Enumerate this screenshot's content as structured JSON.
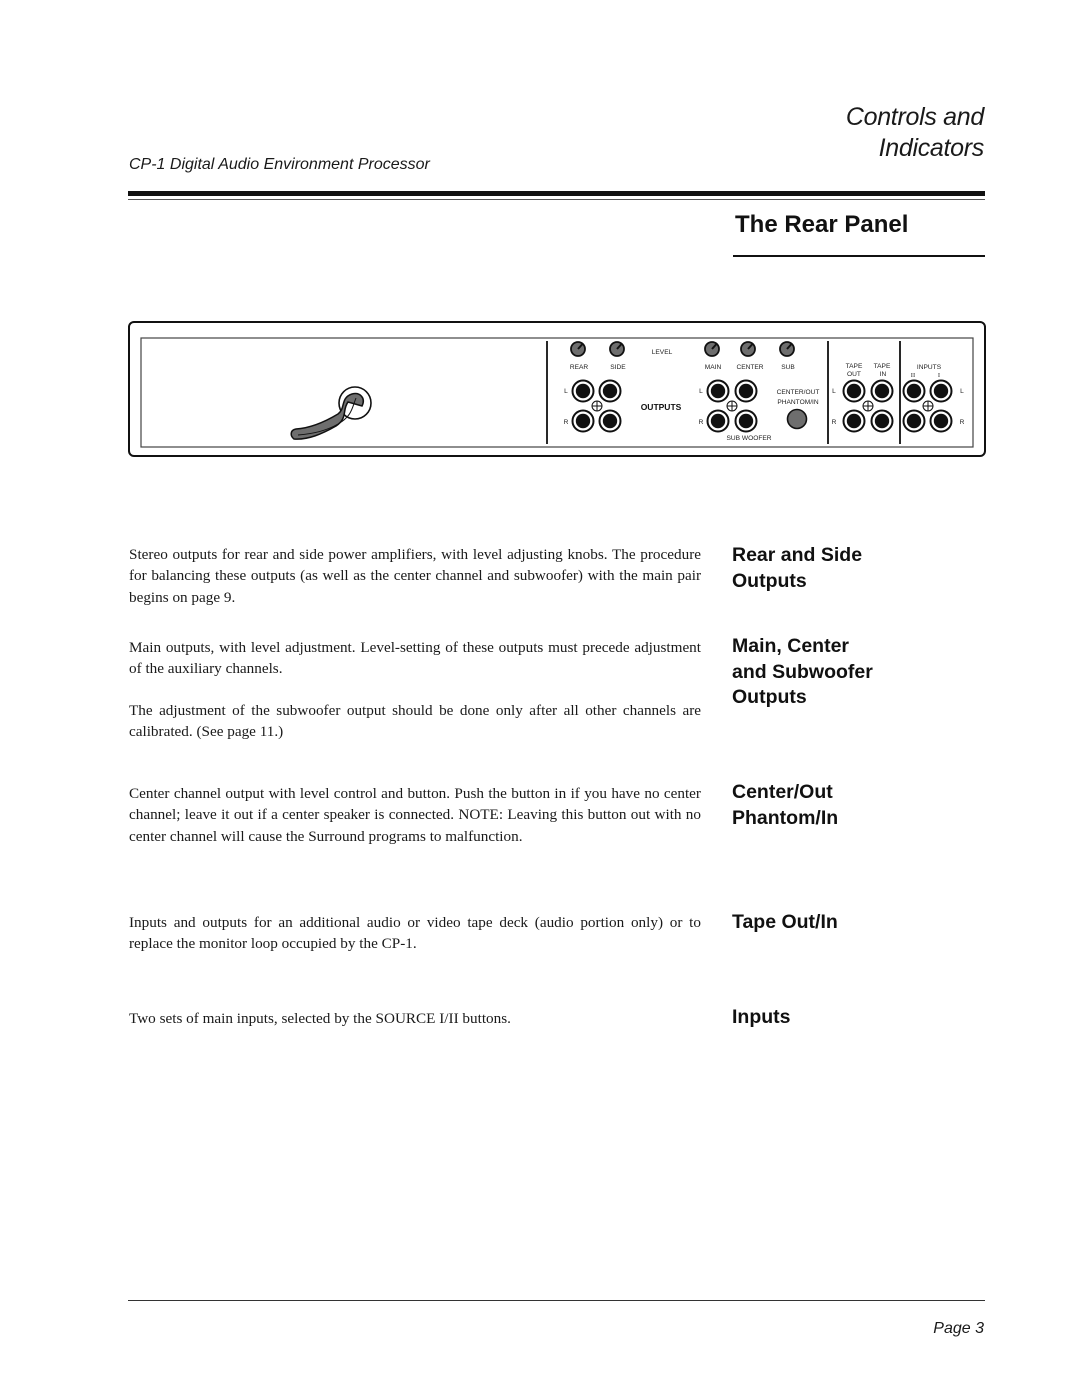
{
  "header": {
    "title_line1": "Controls and",
    "title_line2": "Indicators",
    "subtitle": "CP-1 Digital Audio Environment Processor"
  },
  "section": {
    "title": "The Rear Panel"
  },
  "rear_panel_diagram": {
    "icons": [
      "power-cord-icon",
      "level-knob-icon",
      "rca-jack-icon",
      "ground-symbol-icon",
      "push-button-icon"
    ],
    "labels": {
      "level": "LEVEL",
      "rear": "REAR",
      "side": "SIDE",
      "main": "MAIN",
      "center": "CENTER",
      "sub": "SUB",
      "outputs": "OUTPUTS",
      "left": "L",
      "right": "R",
      "center_out_line1": "CENTER/OUT",
      "center_out_line2": "PHANTOM/IN",
      "sub_woofer": "SUB WOOFER",
      "tape_out_line1": "TAPE",
      "tape_out_line2": "OUT",
      "tape_in_line1": "TAPE",
      "tape_in_line2": "IN",
      "inputs": "INPUTS",
      "input_ii": "II",
      "input_i": "I"
    }
  },
  "descriptions": [
    {
      "heading_lines": [
        "Rear and Side",
        "Outputs"
      ],
      "paragraphs": [
        "Stereo outputs for rear and side power amplifiers, with level adjusting knobs.  The procedure for balancing these outputs (as well as the center channel and subwoofer) with the main pair begins on page 9."
      ]
    },
    {
      "heading_lines": [
        "Main, Center",
        "and Subwoofer",
        "Outputs"
      ],
      "paragraphs": [
        "Main outputs, with level adjustment. Level-setting of these outputs  must precede adjustment of the auxiliary channels.",
        "The adjustment of the subwoofer output should be done only after all other channels are calibrated. (See page 11.)"
      ]
    },
    {
      "heading_lines": [
        "Center/Out",
        "Phantom/In"
      ],
      "paragraphs": [
        "Center channel output with level control and button.  Push the button in if you have no center channel; leave it out if a center speaker is connected. NOTE: Leaving this button out with no center channel will cause the Surround programs to malfunction."
      ]
    },
    {
      "heading_lines": [
        "Tape Out/In"
      ],
      "paragraphs": [
        "Inputs and outputs for an additional audio or video tape deck (audio portion only) or to replace the monitor loop occupied by the CP-1."
      ]
    },
    {
      "heading_lines": [
        "Inputs"
      ],
      "paragraphs": [
        "Two sets of main inputs, selected by the SOURCE I/II buttons."
      ]
    }
  ],
  "footer": {
    "page_label": "Page 3"
  }
}
